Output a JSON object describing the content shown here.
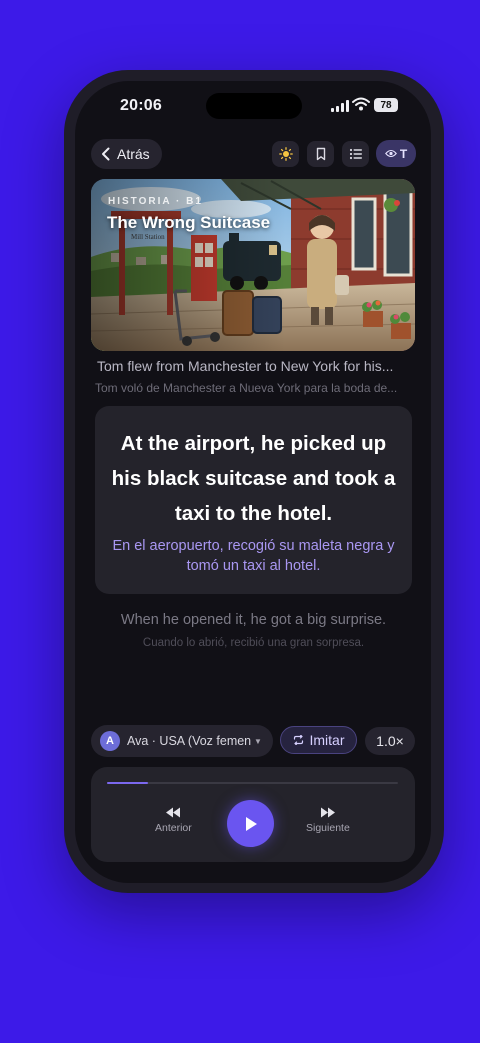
{
  "status_bar": {
    "time": "20:06",
    "battery": "78"
  },
  "nav": {
    "back_label": "Atrás",
    "eye_toggle_label": "T"
  },
  "hero": {
    "label": "HISTORIA · B1",
    "title": "The Wrong Suitcase",
    "sign_text": "Mill Station"
  },
  "previous_sentence": {
    "en": "Tom flew from Manchester to New York for his...",
    "es": "Tom voló de Manchester a Nueva York para la boda de..."
  },
  "current_sentence": {
    "en": "At the airport, he picked up his black suitcase and took a taxi to the hotel.",
    "es": "En el aeropuerto, recogió su maleta negra y tomó un taxi al hotel."
  },
  "next_sentence": {
    "en": "When he opened it, he got a big surprise.",
    "es": "Cuando lo abrió, recibió una gran sorpresa."
  },
  "controls": {
    "voice_avatar": "A",
    "voice_label": "Ava · USA (Voz femenina)",
    "imitate_label": "Imitar",
    "speed_label": "1.0×",
    "prev_label": "Anterior",
    "next_label": "Siguiente",
    "progress": 0.14
  },
  "colors": {
    "background": "#3d1ae8",
    "accent": "#6a55f0",
    "translation": "#a997f2"
  },
  "icons": [
    "chevron-left-icon",
    "sun-icon",
    "bookmark-icon",
    "list-icon",
    "eye-icon",
    "repeat-icon",
    "rewind-icon",
    "play-icon",
    "fast-forward-icon"
  ]
}
